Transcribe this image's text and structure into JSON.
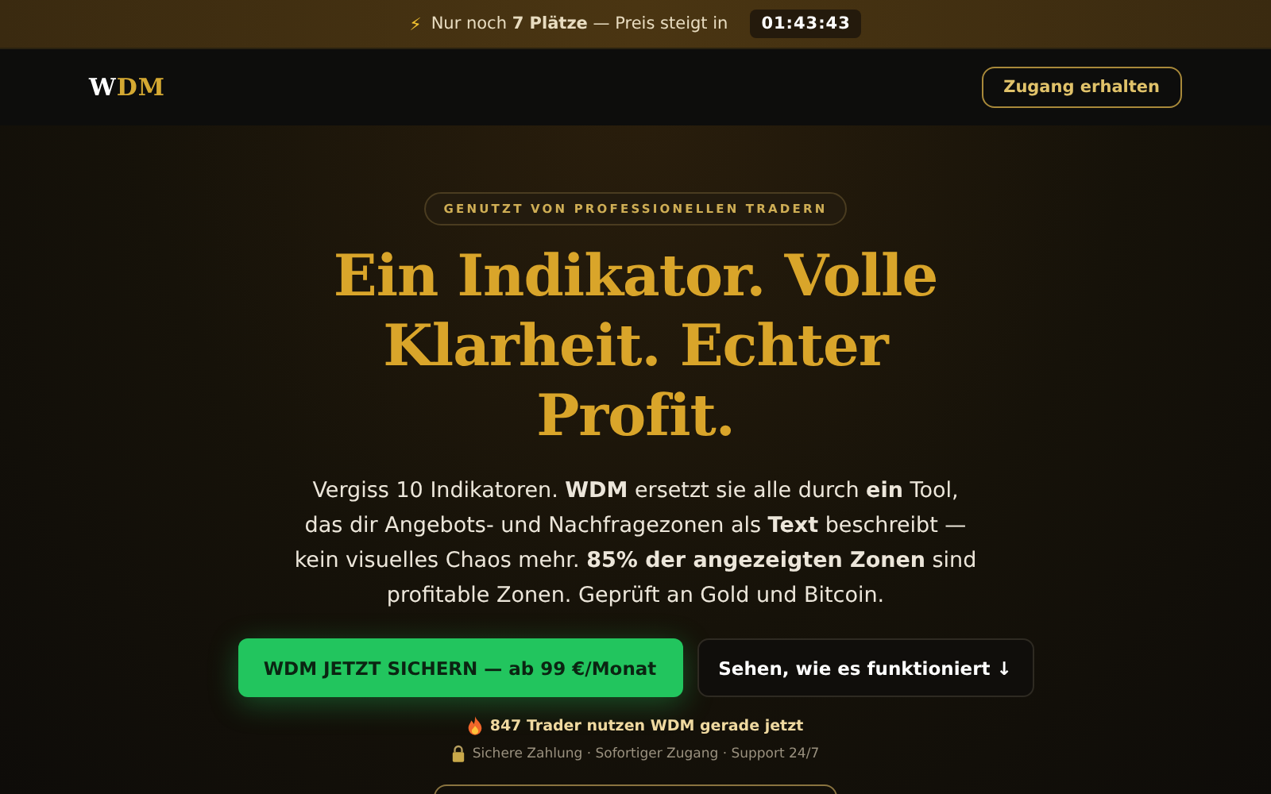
{
  "announcement": {
    "icon": "⚡",
    "text": "Nur noch **7 Plätze** — Preis steigt in",
    "timer": "01:43:43"
  },
  "nav": {
    "logo_first": "W",
    "logo_rest": "DM",
    "cta": "Zugang erhalten"
  },
  "hero": {
    "badge": "GENUTZT VON PROFESSIONELLEN TRADERN",
    "headline": "Ein Indikator. Volle Klarheit. Echter Profit.",
    "description": "Vergiss 10 Indikatoren. **WDM** ersetzt sie alle durch **ein** Tool, das dir Angebots- und Nachfragezonen als **Text** beschreibt — kein visuelles Chaos mehr. **85% der angezeigten Zonen** sind profitable Zonen. Geprüft an Gold und Bitcoin.",
    "buttons": [
      {
        "kind": "primary",
        "label": "WDM JETZT SICHERN — ab 99 €/Monat"
      },
      {
        "kind": "secondary",
        "label": "Sehen, wie es funktioniert ↓"
      }
    ],
    "social_proof": "847 Trader nutzen WDM gerade jetzt",
    "trust": "Sichere Zahlung · Sofortiger Zugang · Support 24/7"
  }
}
